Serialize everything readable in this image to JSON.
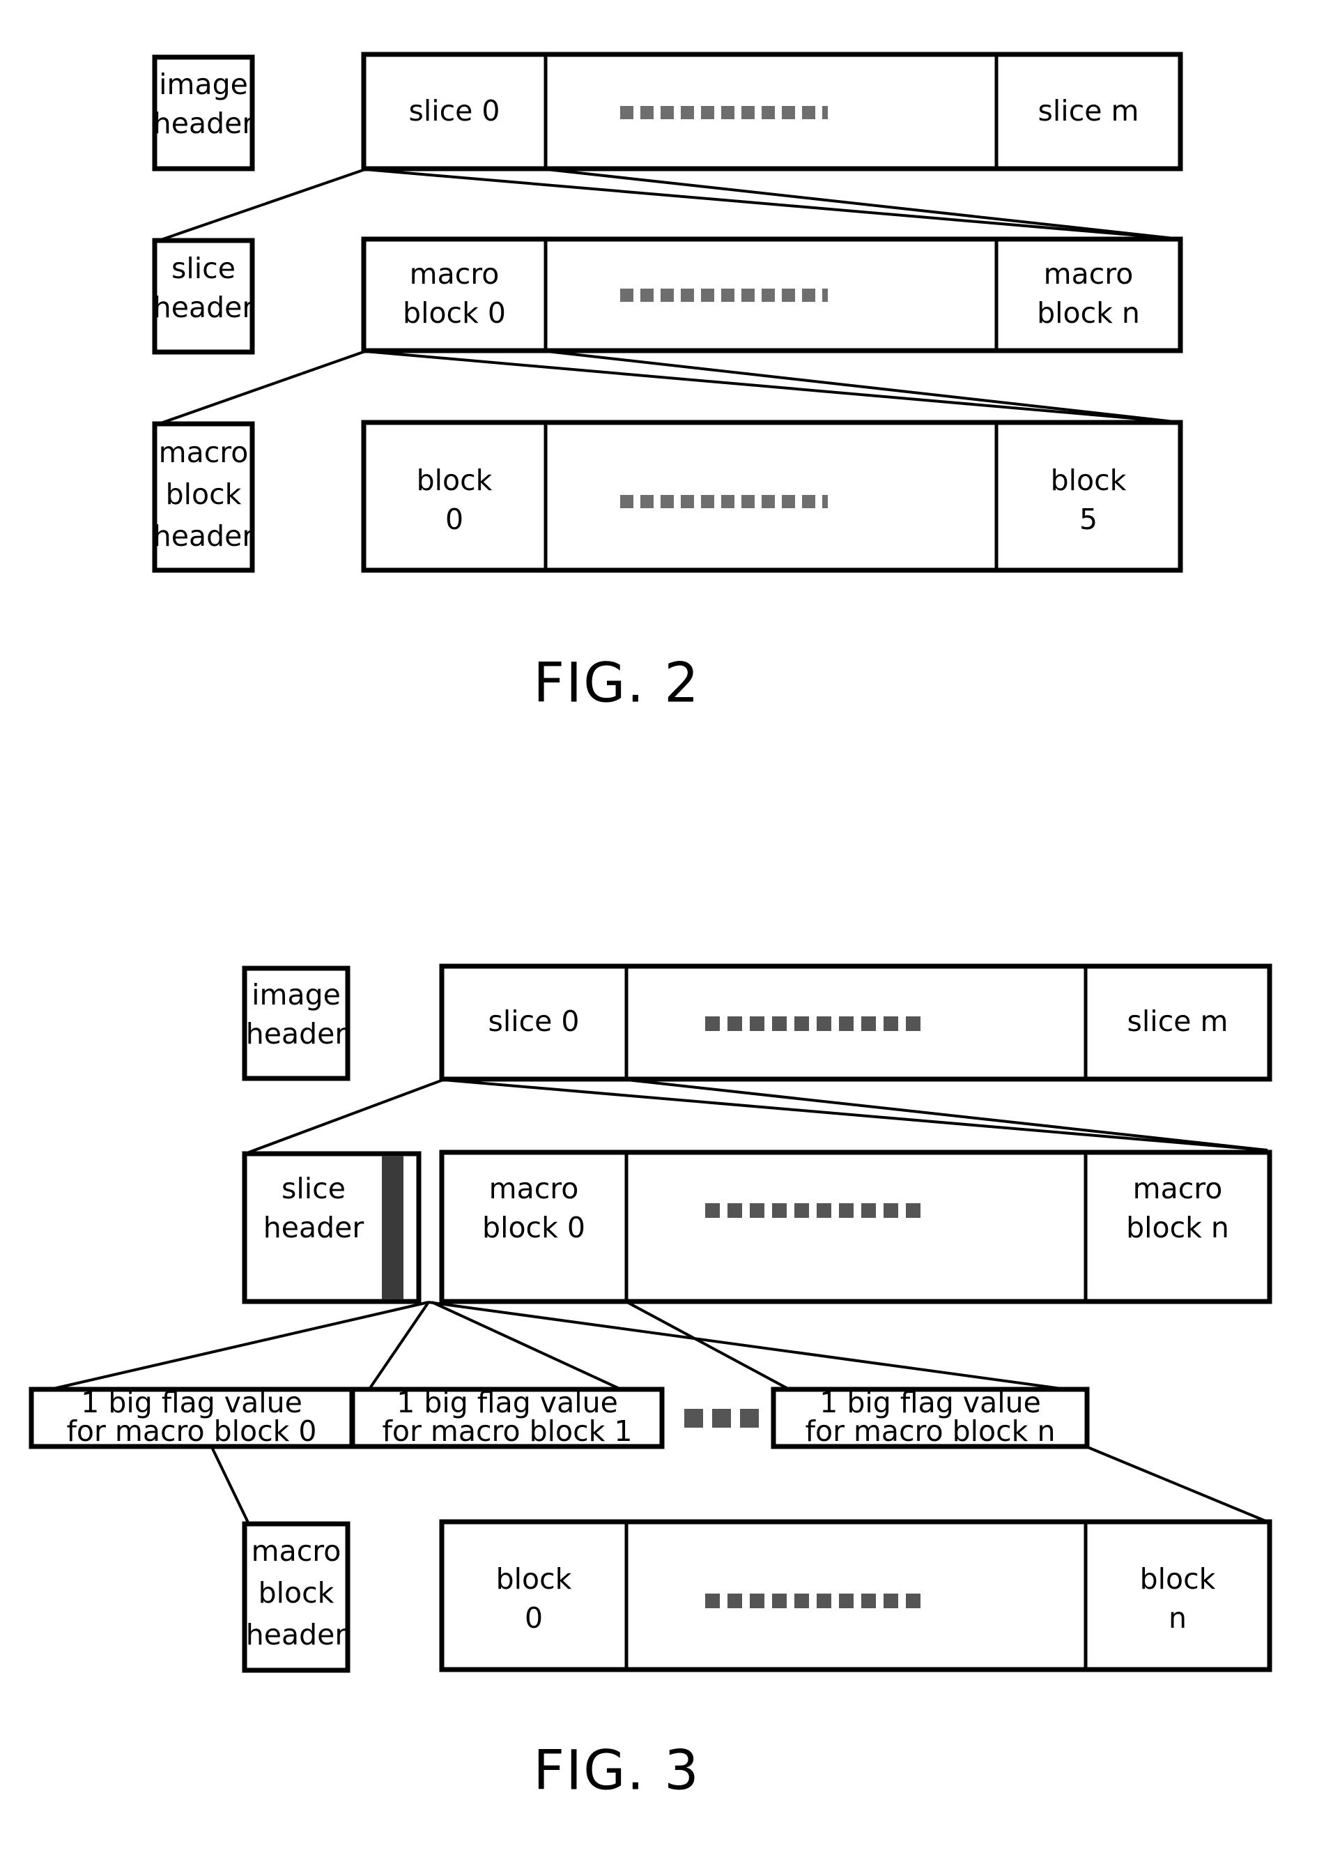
{
  "document": {
    "type": "patent-drawing-sheet",
    "background_color": "#ffffff",
    "ink_color": "#000000"
  },
  "figures": [
    {
      "id": "fig-2",
      "caption": "FIG. 2",
      "rows": [
        {
          "id": "fig2-row-image",
          "header_cell": {
            "lines": [
              "image",
              "header"
            ]
          },
          "cells": [
            {
              "id": "fig2-slice-0",
              "lines": [
                "slice 0"
              ]
            },
            {
              "id": "fig2-slice-ellipsis",
              "lines": [],
              "ellipsis": true
            },
            {
              "id": "fig2-slice-m",
              "lines": [
                "slice m"
              ]
            }
          ]
        },
        {
          "id": "fig2-row-slice",
          "header_cell": {
            "lines": [
              "slice",
              "header"
            ]
          },
          "cells": [
            {
              "id": "fig2-mb-0",
              "lines": [
                "macro",
                "block 0"
              ]
            },
            {
              "id": "fig2-mb-ellipsis",
              "lines": [],
              "ellipsis": true
            },
            {
              "id": "fig2-mb-n",
              "lines": [
                "macro",
                "block n"
              ]
            }
          ]
        },
        {
          "id": "fig2-row-macroblock",
          "header_cell": {
            "lines": [
              "macro",
              "block",
              "header"
            ]
          },
          "cells": [
            {
              "id": "fig2-block-0",
              "lines": [
                "block",
                "0"
              ]
            },
            {
              "id": "fig2-block-ellipsis",
              "lines": [],
              "ellipsis": true
            },
            {
              "id": "fig2-block-5",
              "lines": [
                "block",
                "5"
              ]
            }
          ]
        }
      ]
    },
    {
      "id": "fig-3",
      "caption": "FIG. 3",
      "rows": [
        {
          "id": "fig3-row-image",
          "header_cell": {
            "lines": [
              "image",
              "header"
            ]
          },
          "cells": [
            {
              "id": "fig3-slice-0",
              "lines": [
                "slice 0"
              ]
            },
            {
              "id": "fig3-slice-ellipsis",
              "lines": [],
              "ellipsis": true
            },
            {
              "id": "fig3-slice-m",
              "lines": [
                "slice m"
              ]
            }
          ]
        },
        {
          "id": "fig3-row-slice",
          "header_cell": {
            "lines": [
              "slice",
              "header"
            ],
            "has_shaded_strip": true
          },
          "cells": [
            {
              "id": "fig3-mb-0",
              "lines": [
                "macro",
                "block 0"
              ]
            },
            {
              "id": "fig3-mb-ellipsis",
              "lines": [],
              "ellipsis": true
            },
            {
              "id": "fig3-mb-n",
              "lines": [
                "macro",
                "block n"
              ]
            }
          ]
        },
        {
          "id": "fig3-row-flags",
          "flag_boxes": [
            {
              "id": "fig3-flag-0",
              "lines": [
                "1 big flag value",
                "for macro block 0"
              ]
            },
            {
              "id": "fig3-flag-1",
              "lines": [
                "1 big flag value",
                "for macro block 1"
              ]
            },
            {
              "id": "fig3-flag-n",
              "lines": [
                "1 big flag value",
                "for macro block n"
              ]
            }
          ],
          "ellipsis_between": true
        },
        {
          "id": "fig3-row-macroblock",
          "header_cell": {
            "lines": [
              "macro",
              "block",
              "header"
            ]
          },
          "cells": [
            {
              "id": "fig3-block-0",
              "lines": [
                "block",
                "0"
              ]
            },
            {
              "id": "fig3-block-ellipsis",
              "lines": [],
              "ellipsis": true
            },
            {
              "id": "fig3-block-n",
              "lines": [
                "block",
                "n"
              ]
            }
          ]
        }
      ]
    }
  ]
}
